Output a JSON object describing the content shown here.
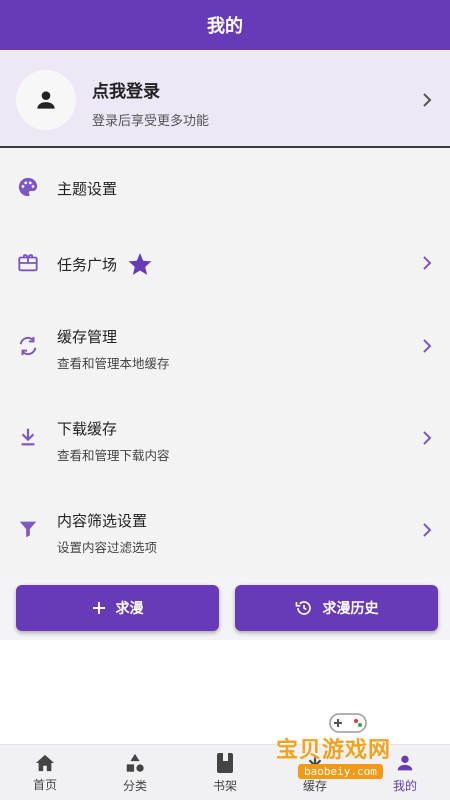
{
  "appbar": {
    "title": "我的"
  },
  "login": {
    "title": "点我登录",
    "subtitle": "登录后享受更多功能"
  },
  "menu": [
    {
      "icon": "palette-icon",
      "title": "主题设置",
      "subtitle": ""
    },
    {
      "icon": "gift-card-icon",
      "title": "任务广场",
      "subtitle": "",
      "badge_icon": "star-icon"
    },
    {
      "icon": "sync-icon",
      "title": "缓存管理",
      "subtitle": "查看和管理本地缓存"
    },
    {
      "icon": "download-icon",
      "title": "下载缓存",
      "subtitle": "查看和管理下载内容"
    },
    {
      "icon": "filter-icon",
      "title": "内容筛选设置",
      "subtitle": "设置内容过滤选项"
    }
  ],
  "buttons": {
    "request": {
      "icon": "plus-icon",
      "label": "求漫"
    },
    "history": {
      "icon": "history-icon",
      "label": "求漫历史"
    }
  },
  "tabs": [
    {
      "icon": "home-icon",
      "label": "首页"
    },
    {
      "icon": "category-icon",
      "label": "分类"
    },
    {
      "icon": "book-icon",
      "label": "书架"
    },
    {
      "icon": "download-tab-icon",
      "label": "缓存"
    },
    {
      "icon": "person-icon",
      "label": "我的",
      "active": true
    }
  ],
  "watermark": {
    "text": "宝贝游戏网",
    "url": "baobeiy.com"
  },
  "colors": {
    "primary": "#673ab7",
    "login_bg": "#ede7f6",
    "menu_bg": "#f3f3f3",
    "accent": "#7e57c2"
  }
}
